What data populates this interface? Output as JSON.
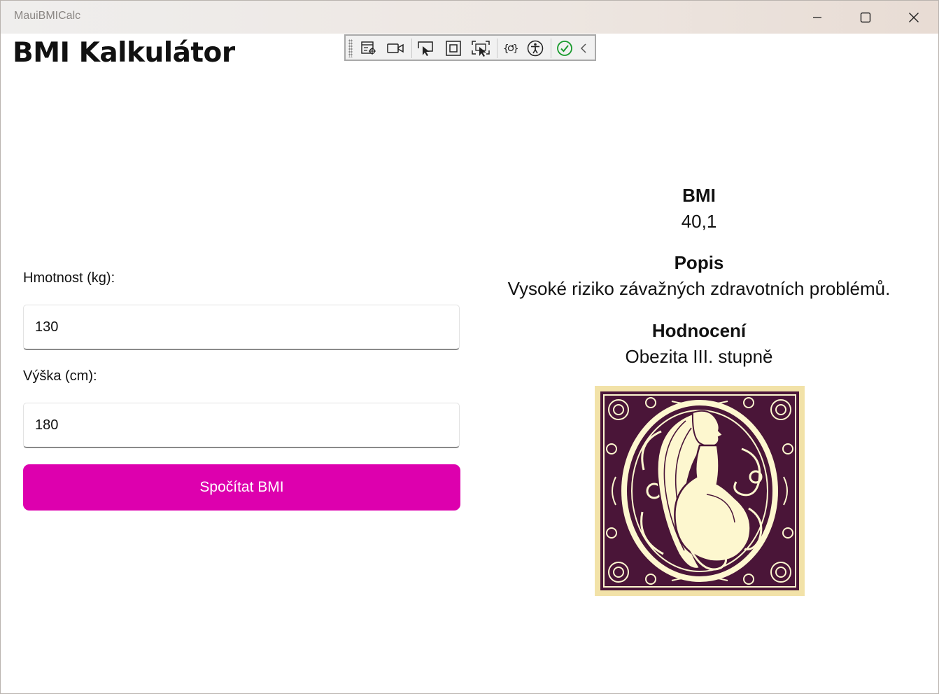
{
  "window": {
    "title": "MauiBMICalc",
    "controls": {
      "minimize": "minimize-icon",
      "maximize": "maximize-icon",
      "close": "close-icon"
    }
  },
  "app": {
    "title": "BMI Kalkulátor"
  },
  "devtools_bar": {
    "tools": [
      "live-visual-tree-icon",
      "record-icon",
      "select-element-icon",
      "display-layout-adorners-icon",
      "track-focused-element-icon",
      "hot-reload-icon",
      "accessibility-icon",
      "checked-icon",
      "collapse-chevron-icon"
    ],
    "check_color": "#1a9b2e"
  },
  "form": {
    "weight_label": "Hmotnost (kg):",
    "weight_value": "130",
    "height_label": "Výška (cm):",
    "height_value": "180",
    "calculate_label": "Spočítat BMI",
    "button_color": "#dd00ae"
  },
  "result": {
    "bmi_heading": "BMI",
    "bmi_value": "40,1",
    "description_heading": "Popis",
    "description_value": "Vysoké riziko závažných zdravotních problémů.",
    "rating_heading": "Hodnocení",
    "rating_value": "Obezita III. stupně"
  },
  "image": {
    "palette": {
      "dark": "#4a1538",
      "light": "#fdf7cf",
      "background": "#f2e2a8"
    }
  }
}
